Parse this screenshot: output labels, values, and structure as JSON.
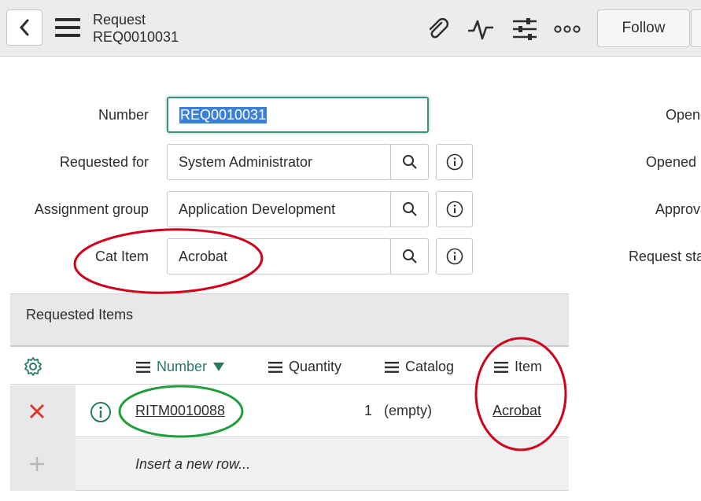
{
  "header": {
    "title": "Request",
    "subtitle": "REQ0010031",
    "follow_label": "Follow",
    "icons": [
      "back-icon",
      "hamburger-icon",
      "paperclip-icon",
      "activity-icon",
      "sliders-icon",
      "more-icon"
    ]
  },
  "form": {
    "number_label": "Number",
    "number_value": "REQ0010031",
    "requested_for_label": "Requested for",
    "requested_for_value": "System Administrator",
    "assignment_group_label": "Assignment group",
    "assignment_group_value": "Application Development",
    "cat_item_label": "Cat Item",
    "cat_item_value": "Acrobat",
    "right_labels": [
      "Opene",
      "Opened b",
      "Approva",
      "Request stat"
    ]
  },
  "related_list": {
    "title": "Requested Items",
    "columns": [
      "Number",
      "Quantity",
      "Catalog",
      "Item"
    ],
    "rows": [
      {
        "number": "RITM0010088",
        "quantity": "1",
        "catalog": "(empty)",
        "item": "Acrobat"
      }
    ],
    "insert_label": "Insert a new row..."
  },
  "colors": {
    "accent": "#287a66",
    "annotation_red": "#d0021b",
    "annotation_green": "#1f9e3a",
    "delete_red": "#e0352b"
  }
}
